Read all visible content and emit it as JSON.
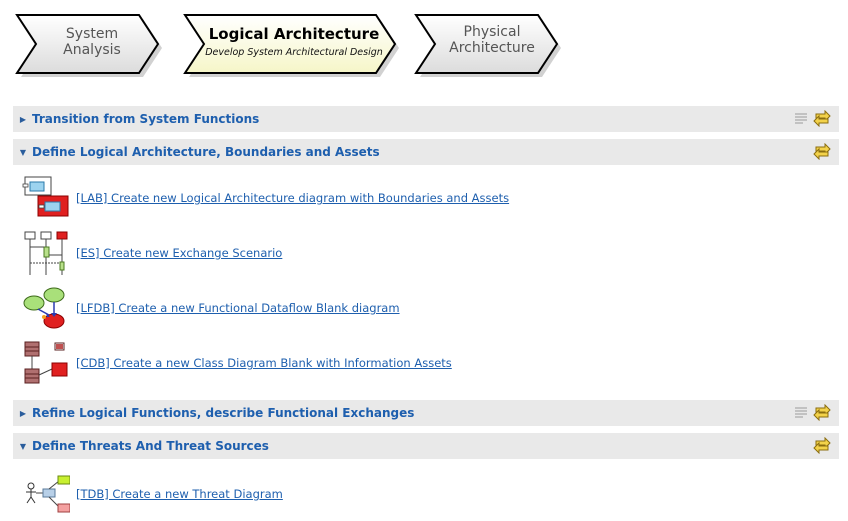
{
  "breadcrumb": {
    "steps": [
      {
        "title": "System\nAnalysis",
        "title_line1": "System",
        "title_line2": "Analysis"
      },
      {
        "title": "Logical Architecture",
        "subtitle": "Develop System Architectural Design"
      },
      {
        "title_line1": "Physical",
        "title_line2": "Architecture"
      }
    ]
  },
  "sections": [
    {
      "title": "Transition from System Functions",
      "expanded": false
    },
    {
      "title": "Define Logical Architecture, Boundaries and Assets",
      "expanded": true,
      "items": [
        {
          "label": "[LAB] Create new Logical Architecture diagram with Boundaries and Assets",
          "icon": "lab-diagram-icon"
        },
        {
          "label": "[ES] Create new Exchange Scenario",
          "icon": "exchange-scenario-icon"
        },
        {
          "label": "[LFDB] Create a new Functional Dataflow Blank diagram",
          "icon": "functional-dataflow-icon"
        },
        {
          "label": "[CDB] Create a new Class Diagram Blank with Information Assets",
          "icon": "class-diagram-icon"
        }
      ]
    },
    {
      "title": "Refine Logical Functions, describe Functional Exchanges",
      "expanded": false
    },
    {
      "title": "Define Threats And Threat Sources",
      "expanded": true,
      "items": [
        {
          "label": "[TDB] Create a new Threat Diagram",
          "icon": "threat-diagram-icon"
        }
      ]
    }
  ],
  "colors": {
    "link": "#1e5fae",
    "section_bg": "#e9e9e9",
    "active_step_fill": "#fdfde0"
  }
}
